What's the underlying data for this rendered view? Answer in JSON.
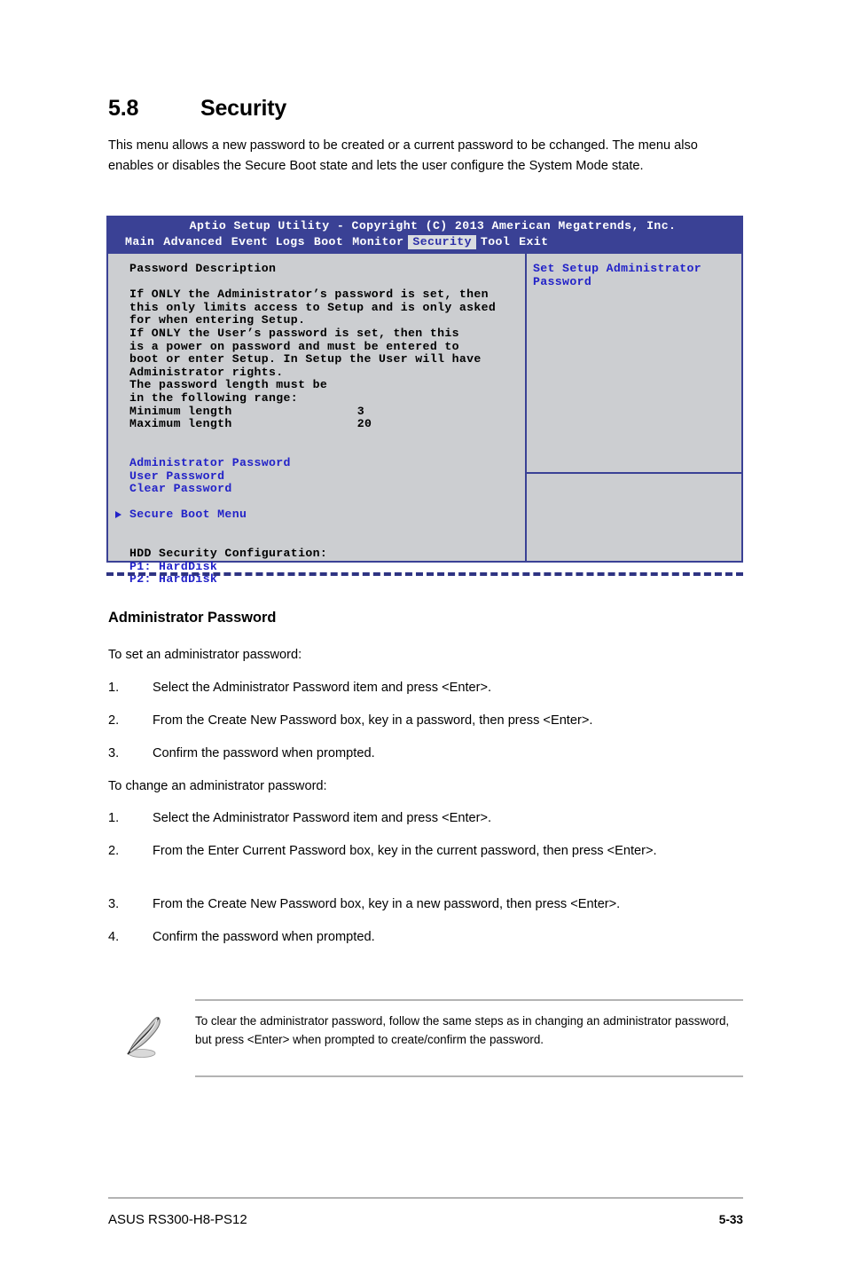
{
  "section": {
    "number": "5.8",
    "title": "Security",
    "intro": "This menu allows a new password to be created or a current password to be cchanged. The menu also enables or disables the Secure Boot state and lets the user configure the System Mode state."
  },
  "bios": {
    "title": "Aptio Setup Utility - Copyright (C) 2013 American Megatrends, Inc.",
    "tabs": [
      {
        "label": "Main",
        "active": false
      },
      {
        "label": "Advanced",
        "active": false
      },
      {
        "label": "Event Logs",
        "active": false
      },
      {
        "label": "Boot",
        "active": false
      },
      {
        "label": "Monitor",
        "active": false
      },
      {
        "label": "Security",
        "active": true
      },
      {
        "label": "Tool",
        "active": false
      },
      {
        "label": "Exit",
        "active": false
      }
    ],
    "left_panel": {
      "heading": "Password Description",
      "description_lines": [
        "If ONLY the Administrator’s password is set, then",
        "this only limits access to Setup and is only asked",
        "for when entering Setup.",
        "If ONLY the User’s password is set, then this",
        "is a power on password and must be entered to",
        "boot or enter Setup. In Setup the User will have",
        "Administrator rights.",
        "The password length must be",
        "in the following range:"
      ],
      "min_length_label": "Minimum length",
      "min_length_value": "3",
      "max_length_label": "Maximum length",
      "max_length_value": "20",
      "items": [
        "Administrator Password",
        "User Password",
        "Clear Password"
      ],
      "submenu": "Secure Boot Menu",
      "hdd_heading": "HDD Security Configuration:",
      "hdd_items": [
        "P1: HardDisk",
        "P2: HardDisk"
      ]
    },
    "help_lines": [
      "Set Setup Administrator",
      "Password"
    ],
    "colors": {
      "header_bar": "#3a4195",
      "panel_bg": "#ccced1",
      "item_blue": "#2222c8",
      "active_tab_bg": "#dadde0"
    }
  },
  "admin_section": {
    "heading": "Administrator Password",
    "set_intro": "To set an administrator password:",
    "set_steps": [
      {
        "num": "1.",
        "text": "Select the Administrator Password item and press <Enter>."
      },
      {
        "num": "2.",
        "text": "From the Create New Password box, key in a password, then press <Enter>."
      },
      {
        "num": "3.",
        "text": "Confirm the password when prompted."
      }
    ],
    "change_intro": "To change an administrator password:",
    "change_steps": [
      {
        "num": "1.",
        "text": "Select the Administrator Password item and press <Enter>."
      },
      {
        "num": "2.",
        "text": "From the Enter Current Password box, key in the current password, then press <Enter>."
      },
      {
        "num": "3.",
        "text": "From the Create New Password box, key in a new password, then press <Enter>."
      },
      {
        "num": "4.",
        "text": "Confirm the password when prompted."
      }
    ]
  },
  "note": {
    "icon": "pencil-note-icon",
    "text": "To clear the administrator password, follow the same steps as in changing an administrator password, but press <Enter> when prompted to create/confirm the password."
  },
  "footer": {
    "product": "ASUS RS300-H8-PS12",
    "page": "5-33"
  }
}
